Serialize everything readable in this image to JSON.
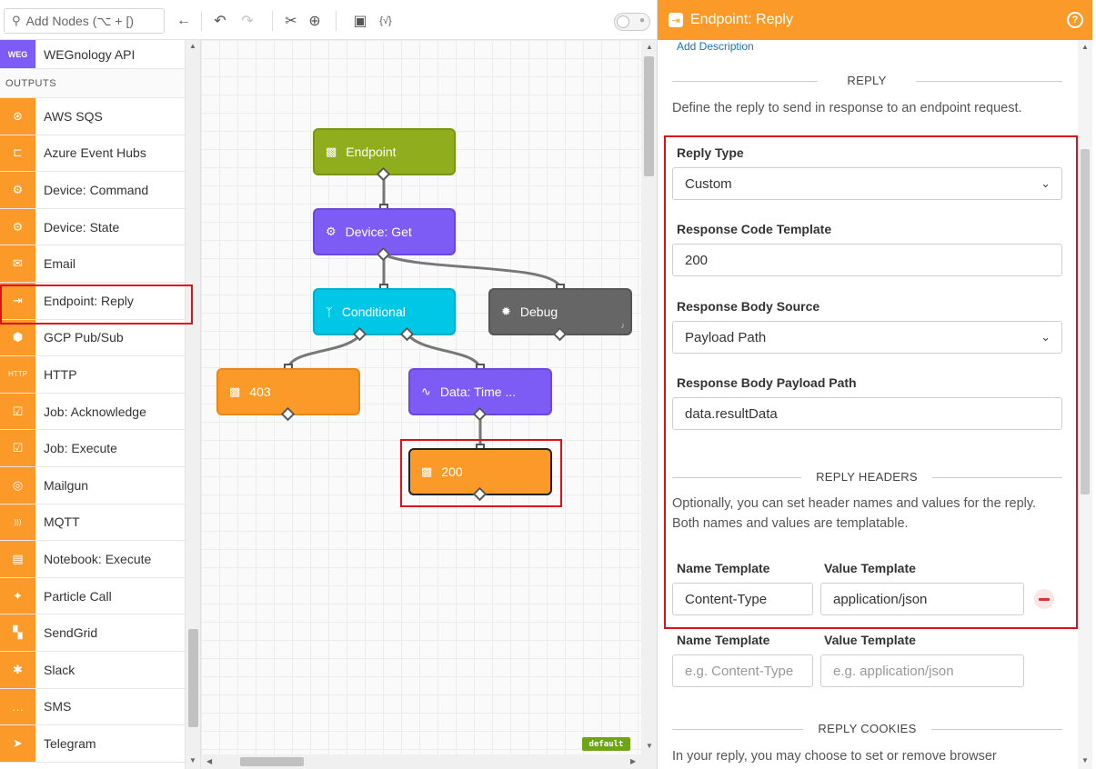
{
  "toolbar": {
    "search_placeholder": "Add Nodes (⌥ + [)",
    "icons": [
      "search-icon",
      "collapse-left-icon",
      "undo-icon",
      "redo-icon",
      "cut-icon",
      "zoom-in-icon",
      "add-comment-icon",
      "variables-icon",
      "lock-toggle"
    ]
  },
  "palette": {
    "top_item": {
      "label": "WEGnology API",
      "icon_text": "WEG"
    },
    "section": "OUTPUTS",
    "items": [
      {
        "label": "AWS SQS",
        "icon": "⊛"
      },
      {
        "label": "Azure Event Hubs",
        "icon": "⊏"
      },
      {
        "label": "Device: Command",
        "icon": "⚙"
      },
      {
        "label": "Device: State",
        "icon": "⚙"
      },
      {
        "label": "Email",
        "icon": "✉"
      },
      {
        "label": "Endpoint: Reply",
        "icon": "⇥"
      },
      {
        "label": "GCP Pub/Sub",
        "icon": "⬢"
      },
      {
        "label": "HTTP",
        "icon": "HTTP"
      },
      {
        "label": "Job: Acknowledge",
        "icon": "☑"
      },
      {
        "label": "Job: Execute",
        "icon": "☑"
      },
      {
        "label": "Mailgun",
        "icon": "◎"
      },
      {
        "label": "MQTT",
        "icon": ")))"
      },
      {
        "label": "Notebook: Execute",
        "icon": "▤"
      },
      {
        "label": "Particle Call",
        "icon": "✦"
      },
      {
        "label": "SendGrid",
        "icon": "▚"
      },
      {
        "label": "Slack",
        "icon": "✱"
      },
      {
        "label": "SMS",
        "icon": "…"
      },
      {
        "label": "Telegram",
        "icon": "➤"
      }
    ]
  },
  "canvas": {
    "nodes": {
      "endpoint": "Endpoint",
      "device_get": "Device: Get",
      "conditional": "Conditional",
      "debug": "Debug",
      "n403": "403",
      "data_time": "Data: Time ...",
      "n200": "200"
    },
    "badge": "default"
  },
  "panel": {
    "title": "Endpoint: Reply",
    "help": "?",
    "add_description": "Add Description",
    "reply_section": "REPLY",
    "reply_desc": "Define the reply to send in response to an endpoint request.",
    "reply_type": {
      "label": "Reply Type",
      "value": "Custom"
    },
    "response_code": {
      "label": "Response Code Template",
      "value": "200"
    },
    "body_source": {
      "label": "Response Body Source",
      "value": "Payload Path"
    },
    "body_path": {
      "label": "Response Body Payload Path",
      "value": "data.resultData"
    },
    "headers_section": "REPLY HEADERS",
    "headers_desc_1": "Optionally, you can set header names and values for the reply.",
    "headers_desc_2": "Both names and values are templatable.",
    "header_row_1": {
      "name_label": "Name Template",
      "value_label": "Value Template",
      "name": "Content-Type",
      "value": "application/json"
    },
    "header_row_2": {
      "name_label": "Name Template",
      "value_label": "Value Template",
      "name_placeholder": "e.g. Content-Type",
      "value_placeholder": "e.g. application/json"
    },
    "cookies_section": "REPLY COOKIES",
    "cookies_desc": "In your reply, you may choose to set or remove browser"
  },
  "colors": {
    "accent_orange": "#fb9a28",
    "node_purple": "#7d5cf5",
    "node_green": "#8fad1d",
    "node_cyan": "#00c7e6",
    "node_gray": "#666666",
    "highlight_red": "#e0101a"
  }
}
